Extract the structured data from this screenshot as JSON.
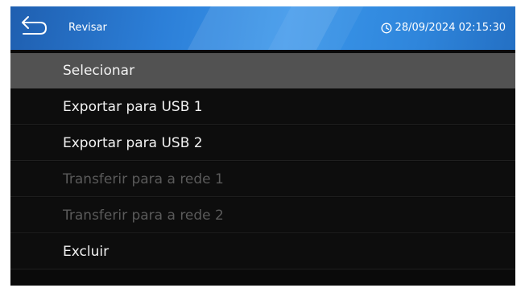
{
  "header": {
    "title": "Revisar",
    "datetime": "28/09/2024 02:15:30",
    "back_icon": "back-arrow-icon",
    "clock_icon": "clock-icon",
    "accent_color": "#2c7fd8"
  },
  "menu": {
    "items": [
      {
        "label": "Selecionar",
        "state": "selected"
      },
      {
        "label": "Exportar para USB 1",
        "state": "enabled"
      },
      {
        "label": "Exportar para USB 2",
        "state": "enabled"
      },
      {
        "label": "Transferir para a rede 1",
        "state": "disabled"
      },
      {
        "label": "Transferir para a rede 2",
        "state": "disabled"
      },
      {
        "label": "Excluir",
        "state": "enabled"
      }
    ]
  }
}
